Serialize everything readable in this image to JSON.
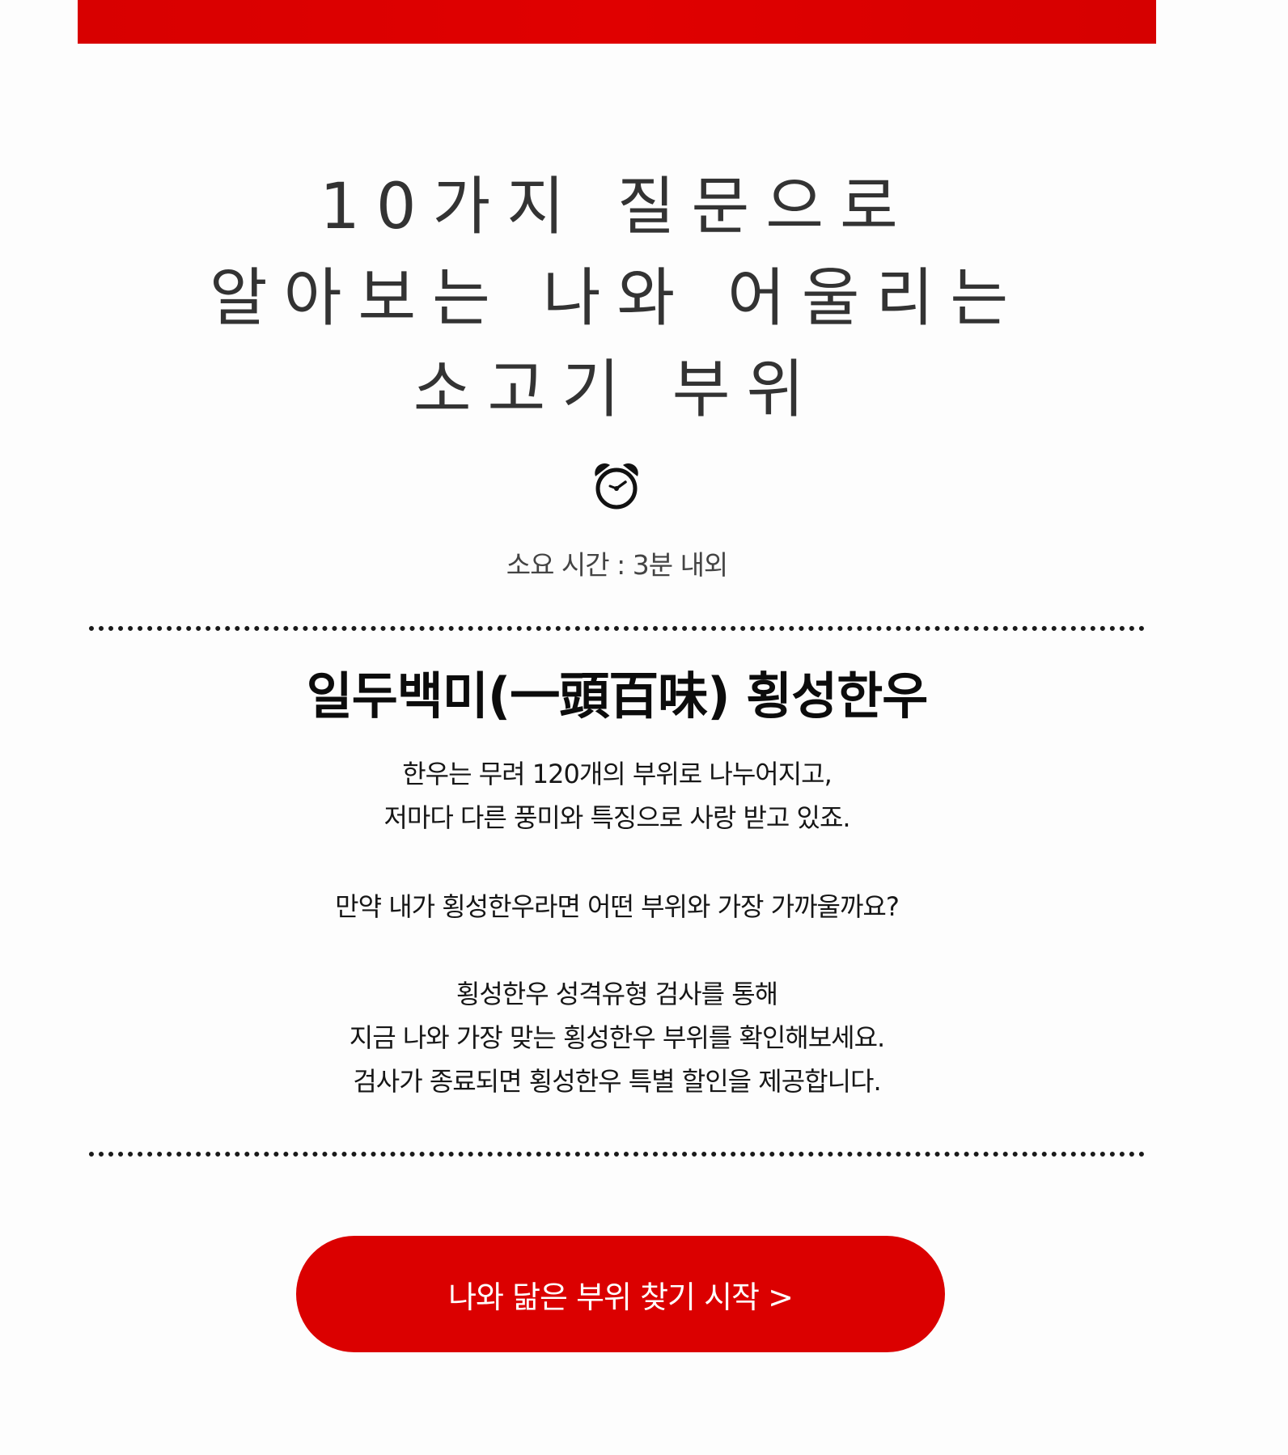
{
  "hero": {
    "title_lines": [
      "10가지 질문으로",
      "알아보는 나와 어울리는",
      "소고기 부위"
    ]
  },
  "clock": {
    "icon": "alarm-clock-icon"
  },
  "duration_text": "소요 시간 : 3분 내외",
  "section": {
    "title": "일두백미(一頭百味) 횡성한우",
    "paragraph1": [
      "한우는 무려 120개의 부위로 나누어지고,",
      "저마다 다른 풍미와 특징으로 사랑 받고 있죠."
    ],
    "paragraph2": [
      "만약 내가 횡성한우라면 어떤 부위와 가장 가까울까요?"
    ],
    "paragraph3": [
      "횡성한우 성격유형 검사를 통해",
      "지금 나와 가장 맞는 횡성한우 부위를 확인해보세요.",
      "검사가 종료되면 횡성한우 특별 할인을 제공합니다."
    ]
  },
  "cta": {
    "label": "나와 닮은 부위 찾기 시작 >"
  },
  "colors": {
    "brand_red": "#db0000",
    "text_dark": "#111111",
    "background": "#fdfdfd"
  }
}
